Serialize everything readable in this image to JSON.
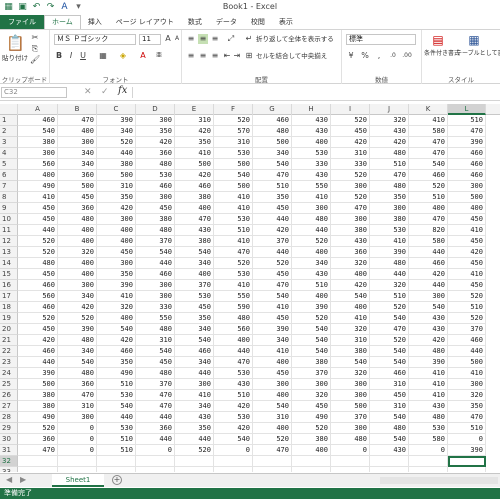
{
  "window": {
    "title": "Book1 - Excel"
  },
  "quick_access": {
    "save_icon": "save-icon",
    "undo_icon": "undo-icon",
    "redo_icon": "redo-icon",
    "font_color_icon": "font-color-icon"
  },
  "ribbon_tabs": [
    "ファイル",
    "ホーム",
    "挿入",
    "ページ レイアウト",
    "数式",
    "データ",
    "校閲",
    "表示"
  ],
  "ribbon": {
    "clipboard": {
      "paste_label": "貼り付け",
      "group_label": "クリップボード"
    },
    "font": {
      "font_name": "ＭＳ Ｐゴシック",
      "font_size": "11",
      "group_label": "フォント"
    },
    "alignment": {
      "wrap_text": "折り返して全体を表示する",
      "merge_center": "セルを結合して中央揃え",
      "group_label": "配置"
    },
    "number": {
      "format": "標準",
      "group_label": "数値"
    },
    "styles": {
      "conditional_label": "条件付き書式",
      "table_label": "テーブルとして書式設定",
      "group_label": "スタイル"
    }
  },
  "formula_bar": {
    "name_box": "C32",
    "fx_label": "fx",
    "value": ""
  },
  "columns": [
    "A",
    "B",
    "C",
    "D",
    "E",
    "F",
    "G",
    "H",
    "I",
    "J",
    "K",
    "L"
  ],
  "selected_column": "L",
  "selected_row": "32",
  "rows": [
    {
      "n": "1",
      "v": [
        "460",
        "470",
        "390",
        "300",
        "310",
        "520",
        "460",
        "430",
        "520",
        "320",
        "410",
        "510"
      ]
    },
    {
      "n": "2",
      "v": [
        "540",
        "400",
        "340",
        "350",
        "420",
        "570",
        "480",
        "430",
        "450",
        "430",
        "580",
        "470"
      ]
    },
    {
      "n": "3",
      "v": [
        "380",
        "300",
        "520",
        "420",
        "350",
        "310",
        "500",
        "400",
        "420",
        "420",
        "470",
        "390"
      ]
    },
    {
      "n": "4",
      "v": [
        "300",
        "340",
        "440",
        "360",
        "410",
        "530",
        "340",
        "530",
        "310",
        "480",
        "470",
        "460"
      ]
    },
    {
      "n": "5",
      "v": [
        "560",
        "340",
        "380",
        "480",
        "500",
        "500",
        "540",
        "330",
        "330",
        "510",
        "540",
        "460"
      ]
    },
    {
      "n": "6",
      "v": [
        "400",
        "360",
        "500",
        "530",
        "420",
        "540",
        "470",
        "430",
        "520",
        "470",
        "460",
        "460"
      ]
    },
    {
      "n": "7",
      "v": [
        "490",
        "500",
        "310",
        "460",
        "460",
        "500",
        "510",
        "550",
        "300",
        "480",
        "520",
        "300"
      ]
    },
    {
      "n": "8",
      "v": [
        "410",
        "450",
        "350",
        "300",
        "380",
        "410",
        "350",
        "410",
        "520",
        "350",
        "510",
        "500"
      ]
    },
    {
      "n": "9",
      "v": [
        "450",
        "360",
        "420",
        "450",
        "400",
        "410",
        "450",
        "300",
        "470",
        "300",
        "400",
        "400"
      ]
    },
    {
      "n": "10",
      "v": [
        "450",
        "480",
        "300",
        "380",
        "470",
        "530",
        "440",
        "480",
        "300",
        "380",
        "470",
        "450"
      ]
    },
    {
      "n": "11",
      "v": [
        "440",
        "400",
        "400",
        "480",
        "430",
        "510",
        "420",
        "440",
        "380",
        "530",
        "820",
        "410"
      ]
    },
    {
      "n": "12",
      "v": [
        "520",
        "400",
        "400",
        "370",
        "380",
        "410",
        "370",
        "520",
        "430",
        "410",
        "580",
        "450"
      ]
    },
    {
      "n": "13",
      "v": [
        "520",
        "320",
        "450",
        "540",
        "540",
        "470",
        "440",
        "400",
        "360",
        "390",
        "440",
        "420"
      ]
    },
    {
      "n": "14",
      "v": [
        "480",
        "400",
        "300",
        "440",
        "340",
        "520",
        "520",
        "340",
        "320",
        "480",
        "460",
        "450"
      ]
    },
    {
      "n": "15",
      "v": [
        "450",
        "400",
        "350",
        "460",
        "400",
        "530",
        "450",
        "430",
        "400",
        "440",
        "420",
        "410"
      ]
    },
    {
      "n": "16",
      "v": [
        "460",
        "300",
        "390",
        "300",
        "370",
        "410",
        "470",
        "510",
        "420",
        "320",
        "440",
        "450"
      ]
    },
    {
      "n": "17",
      "v": [
        "560",
        "340",
        "410",
        "300",
        "530",
        "550",
        "540",
        "400",
        "540",
        "510",
        "300",
        "520"
      ]
    },
    {
      "n": "18",
      "v": [
        "460",
        "420",
        "320",
        "330",
        "450",
        "590",
        "410",
        "390",
        "400",
        "520",
        "540",
        "510"
      ]
    },
    {
      "n": "19",
      "v": [
        "520",
        "520",
        "400",
        "550",
        "350",
        "480",
        "450",
        "520",
        "410",
        "540",
        "430",
        "520"
      ]
    },
    {
      "n": "20",
      "v": [
        "450",
        "390",
        "540",
        "480",
        "340",
        "560",
        "390",
        "540",
        "320",
        "470",
        "430",
        "370"
      ]
    },
    {
      "n": "21",
      "v": [
        "420",
        "480",
        "420",
        "310",
        "540",
        "400",
        "340",
        "540",
        "310",
        "520",
        "420",
        "460"
      ]
    },
    {
      "n": "22",
      "v": [
        "460",
        "340",
        "460",
        "540",
        "460",
        "440",
        "410",
        "540",
        "380",
        "540",
        "480",
        "440"
      ]
    },
    {
      "n": "23",
      "v": [
        "440",
        "540",
        "350",
        "450",
        "340",
        "470",
        "400",
        "380",
        "540",
        "540",
        "390",
        "500"
      ]
    },
    {
      "n": "24",
      "v": [
        "390",
        "480",
        "490",
        "480",
        "440",
        "530",
        "450",
        "370",
        "320",
        "460",
        "410",
        "410"
      ]
    },
    {
      "n": "25",
      "v": [
        "500",
        "360",
        "510",
        "370",
        "300",
        "430",
        "300",
        "300",
        "300",
        "310",
        "410",
        "300"
      ]
    },
    {
      "n": "26",
      "v": [
        "380",
        "470",
        "530",
        "470",
        "410",
        "510",
        "400",
        "320",
        "300",
        "450",
        "410",
        "320"
      ]
    },
    {
      "n": "27",
      "v": [
        "380",
        "310",
        "540",
        "470",
        "340",
        "420",
        "540",
        "450",
        "500",
        "310",
        "430",
        "350"
      ]
    },
    {
      "n": "28",
      "v": [
        "490",
        "300",
        "440",
        "440",
        "430",
        "530",
        "310",
        "490",
        "370",
        "540",
        "480",
        "470"
      ]
    },
    {
      "n": "29",
      "v": [
        "520",
        "0",
        "530",
        "360",
        "350",
        "420",
        "400",
        "520",
        "300",
        "480",
        "530",
        "510"
      ]
    },
    {
      "n": "30",
      "v": [
        "360",
        "0",
        "510",
        "440",
        "440",
        "540",
        "520",
        "380",
        "480",
        "540",
        "580",
        "0"
      ]
    },
    {
      "n": "31",
      "v": [
        "470",
        "0",
        "510",
        "0",
        "520",
        "0",
        "470",
        "400",
        "0",
        "430",
        "0",
        "390"
      ]
    },
    {
      "n": "32",
      "v": [
        "",
        "",
        "",
        "",
        "",
        "",
        "",
        "",
        "",
        "",
        "",
        ""
      ]
    },
    {
      "n": "33",
      "v": [
        "",
        "",
        "",
        "",
        "",
        "",
        "",
        "",
        "",
        "",
        "",
        ""
      ]
    },
    {
      "n": "34",
      "v": [
        "",
        "",
        "",
        "",
        "",
        "",
        "",
        "",
        "",
        "",
        "",
        ""
      ]
    },
    {
      "n": "35",
      "v": [
        "",
        "",
        "",
        "",
        "",
        "",
        "",
        "",
        "",
        "",
        "",
        ""
      ]
    },
    {
      "n": "36",
      "v": [
        "",
        "",
        "",
        "",
        "",
        "",
        "",
        "",
        "",
        "",
        "",
        ""
      ]
    },
    {
      "n": "37",
      "v": [
        "",
        "",
        "",
        "",
        "",
        "",
        "",
        "",
        "",
        "",
        "",
        ""
      ]
    }
  ],
  "sheet_tabs": {
    "sheet1": "Sheet1",
    "add_icon": "plus-icon"
  },
  "status_bar": {
    "text": "準備完了"
  }
}
